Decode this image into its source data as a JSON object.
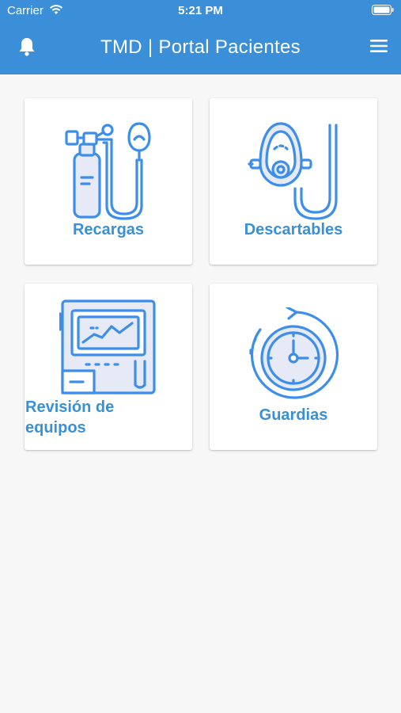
{
  "status_bar": {
    "carrier": "Carrier",
    "time": "5:21 PM"
  },
  "header": {
    "title": "TMD | Portal Pacientes",
    "bell_icon": "bell-icon",
    "menu_icon": "hamburger-menu-icon"
  },
  "colors": {
    "header_bg": "#3b8fd8",
    "accent": "#3a90d7",
    "icon_stroke": "#3d8eea",
    "icon_fill": "#e6eaf6",
    "background": "#f7f7f7"
  },
  "cards": [
    {
      "label": "Recargas",
      "icon": "oxygen-tank-icon"
    },
    {
      "label": "Descartables",
      "icon": "oxygen-mask-icon"
    },
    {
      "label": "Revisión de equipos",
      "line1": "Revisión de",
      "line2": "equipos",
      "icon": "monitor-equipment-icon"
    },
    {
      "label": "Guardias",
      "icon": "clock-refresh-icon"
    }
  ]
}
